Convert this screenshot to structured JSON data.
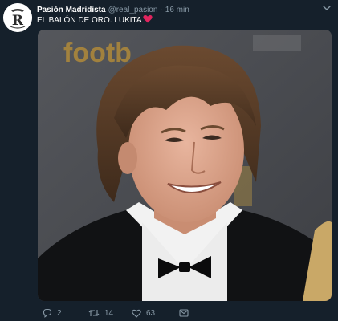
{
  "tweet": {
    "author_name": "Pasión Madridista",
    "handle": "@real_pasion",
    "separator": "·",
    "time": "16 min",
    "text": "EL BALÓN DE ORO. LUKITA",
    "emoji": "red-heart",
    "avatar_letter": "R",
    "media_background_text": "footb"
  },
  "actions": {
    "replies": "2",
    "retweets": "14",
    "likes": "63",
    "dm": ""
  },
  "colors": {
    "background": "#15202b",
    "secondary_text": "#8899a6",
    "heart": "#e0245e"
  },
  "icons": [
    "chevron-down-icon",
    "reply-icon",
    "retweet-icon",
    "like-icon",
    "direct-message-icon"
  ]
}
